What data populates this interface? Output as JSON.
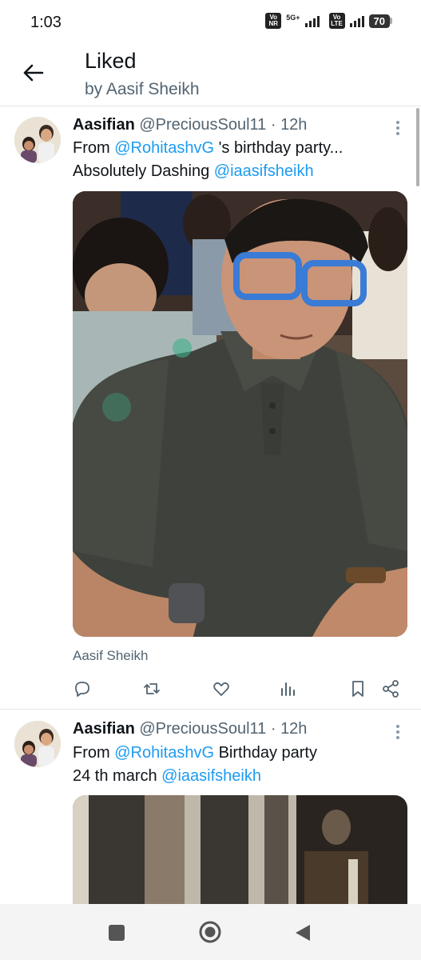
{
  "status_bar": {
    "time": "1:03",
    "network_1": "5G+",
    "volte_1": "Vo NR",
    "volte_2": "Vo LTE",
    "battery": "70"
  },
  "header": {
    "title": "Liked",
    "subtitle": "by Aasif Sheikh"
  },
  "tweets": [
    {
      "display_name": "Aasifian",
      "handle": "@PreciousSoul11",
      "separator": " · ",
      "time": "12h",
      "text_parts": [
        "From ",
        "@RohitashvG",
        " 's birthday party...",
        "Absolutely Dashing ",
        "@iaasifsheikh"
      ],
      "photo_tag": "Aasif Sheikh",
      "actions": [
        "reply-icon",
        "retweet-icon",
        "like-icon",
        "views-icon",
        "bookmark-icon",
        "share-icon"
      ]
    },
    {
      "display_name": "Aasifian",
      "handle": "@PreciousSoul11",
      "separator": " · ",
      "time": "12h",
      "text_parts": [
        "From ",
        "@RohitashvG",
        " Birthday party",
        "24 th march ",
        "@iaasifsheikh"
      ]
    }
  ],
  "colors": {
    "accent": "#1d9bf0",
    "secondary_text": "#536471",
    "primary_text": "#0f1419"
  }
}
